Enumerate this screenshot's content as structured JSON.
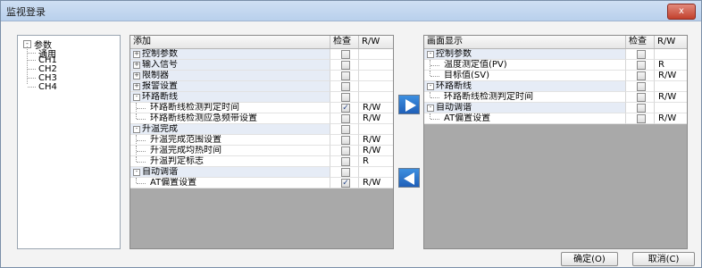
{
  "window": {
    "title": "监视登录",
    "close_label": "x"
  },
  "tree": {
    "root": {
      "toggle": "-",
      "label": "参数"
    },
    "children": [
      "通用",
      "CH1",
      "CH2",
      "CH3",
      "CH4"
    ]
  },
  "left_grid": {
    "headers": {
      "name": "添加",
      "check": "检查",
      "rw": "R/W"
    },
    "rows": [
      {
        "label": "控制参数",
        "rw": ""
      },
      {
        "label": "输入信号",
        "rw": ""
      },
      {
        "label": "限制器",
        "rw": ""
      },
      {
        "label": "报警设置",
        "rw": ""
      },
      {
        "label": "环路断线",
        "rw": ""
      },
      {
        "label": "环路断线检测判定时间",
        "rw": "R/W"
      },
      {
        "label": "环路断线检测应急频带设置",
        "rw": "R/W"
      },
      {
        "label": "升温完成",
        "rw": ""
      },
      {
        "label": "升温完成范围设置",
        "rw": "R/W"
      },
      {
        "label": "升温完成均热时间",
        "rw": "R/W"
      },
      {
        "label": "升温判定标志",
        "rw": "R"
      },
      {
        "label": "自动调谐",
        "rw": ""
      },
      {
        "label": "AT偏置设置",
        "rw": "R/W"
      }
    ]
  },
  "right_grid": {
    "headers": {
      "name": "画面显示",
      "check": "检查",
      "rw": "R/W"
    },
    "rows": [
      {
        "label": "控制参数",
        "rw": ""
      },
      {
        "label": "温度测定值(PV)",
        "rw": "R"
      },
      {
        "label": "目标值(SV)",
        "rw": "R/W"
      },
      {
        "label": "环路断线",
        "rw": ""
      },
      {
        "label": "环路断线检测判定时间",
        "rw": "R/W"
      },
      {
        "label": "自动调谐",
        "rw": ""
      },
      {
        "label": "AT偏置设置",
        "rw": "R/W"
      }
    ]
  },
  "buttons": {
    "ok": "确定(O)",
    "cancel": "取消(C)"
  },
  "icons": {
    "add": "arrow-right-icon",
    "remove": "arrow-left-icon"
  },
  "colors": {
    "arrow": "#2f7ad0",
    "category_bg": "#e6ecf6",
    "empty_area": "#a9a9a9"
  }
}
